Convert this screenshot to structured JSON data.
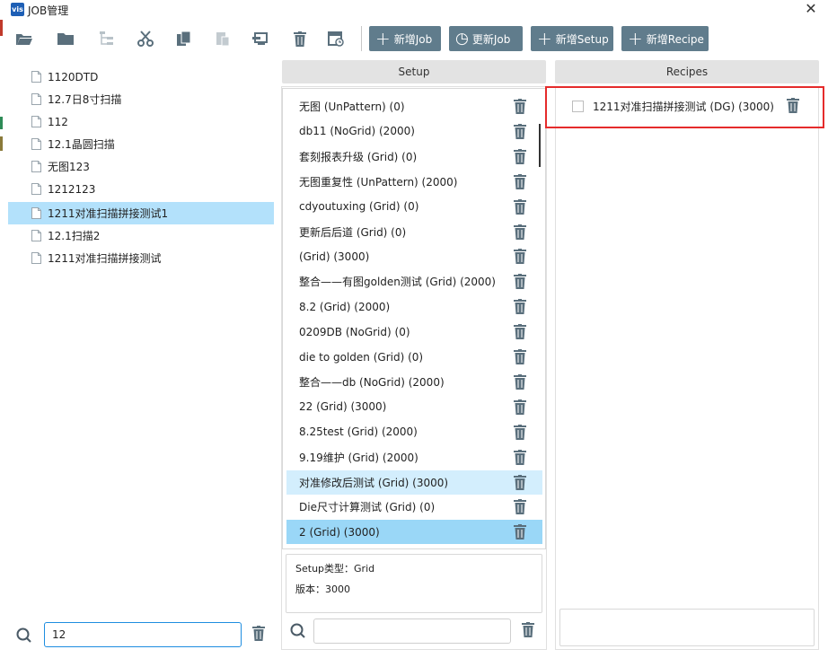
{
  "window": {
    "title": "JOB管理",
    "logo_text": "vis",
    "close_glyph": "✕"
  },
  "toolbar": {
    "icons": [
      "open-folder-icon",
      "folder-icon",
      "tree-structure-icon",
      "cut-icon",
      "copy-icon",
      "paste-icon",
      "export-icon",
      "delete-icon",
      "schedule-icon"
    ],
    "buttons": [
      {
        "label": "新增Job",
        "glyph": "+"
      },
      {
        "label": "更新Job",
        "glyph": "◷"
      },
      {
        "label": "新增Setup",
        "glyph": "+"
      },
      {
        "label": "新增Recipe",
        "glyph": "+"
      }
    ]
  },
  "job_tree": {
    "items": [
      {
        "label": "1120DTD"
      },
      {
        "label": "12.7日8寸扫描"
      },
      {
        "label": "112"
      },
      {
        "label": "12.1晶圆扫描"
      },
      {
        "label": "无图123"
      },
      {
        "label": "1212123"
      },
      {
        "label": "1211对准扫描拼接测试1"
      },
      {
        "label": "12.1扫描2"
      },
      {
        "label": "1211对准扫描拼接测试"
      }
    ],
    "selected_index": 6,
    "search_value": "12"
  },
  "setup": {
    "header": "Setup",
    "items": [
      {
        "label": "无图 (UnPattern) (0)"
      },
      {
        "label": "db11 (NoGrid) (2000)"
      },
      {
        "label": "套刻报表升级 (Grid) (0)"
      },
      {
        "label": "无图重复性 (UnPattern) (2000)"
      },
      {
        "label": "cdyoutuxing (Grid) (0)"
      },
      {
        "label": "更新后后道 (Grid) (0)"
      },
      {
        "label": " (Grid) (3000)"
      },
      {
        "label": "整合——有图golden测试 (Grid) (2000)"
      },
      {
        "label": "8.2 (Grid) (2000)"
      },
      {
        "label": "0209DB (NoGrid) (0)"
      },
      {
        "label": "die to golden (Grid) (0)"
      },
      {
        "label": "整合——db (NoGrid) (2000)"
      },
      {
        "label": "22 (Grid) (3000)"
      },
      {
        "label": "8.25test (Grid) (2000)"
      },
      {
        "label": "9.19维护 (Grid) (2000)"
      },
      {
        "label": "对准修改后测试 (Grid) (3000)"
      },
      {
        "label": "Die尺寸计算测试 (Grid) (0)"
      },
      {
        "label": "2 (Grid) (3000)"
      }
    ],
    "hover_index": 15,
    "selected_index": 17,
    "info": {
      "type_line": "Setup类型：Grid",
      "version_line": "版本：3000"
    },
    "search_value": ""
  },
  "recipes": {
    "header": "Recipes",
    "items": [
      {
        "label": "1211对准扫描拼接测试 (DG) (3000)",
        "checked": false
      }
    ]
  },
  "colors": {
    "accent": "#607c8c",
    "selected": "#9ad7f7",
    "highlight_border": "#e52b2b",
    "focus_border": "#1e8de0"
  }
}
